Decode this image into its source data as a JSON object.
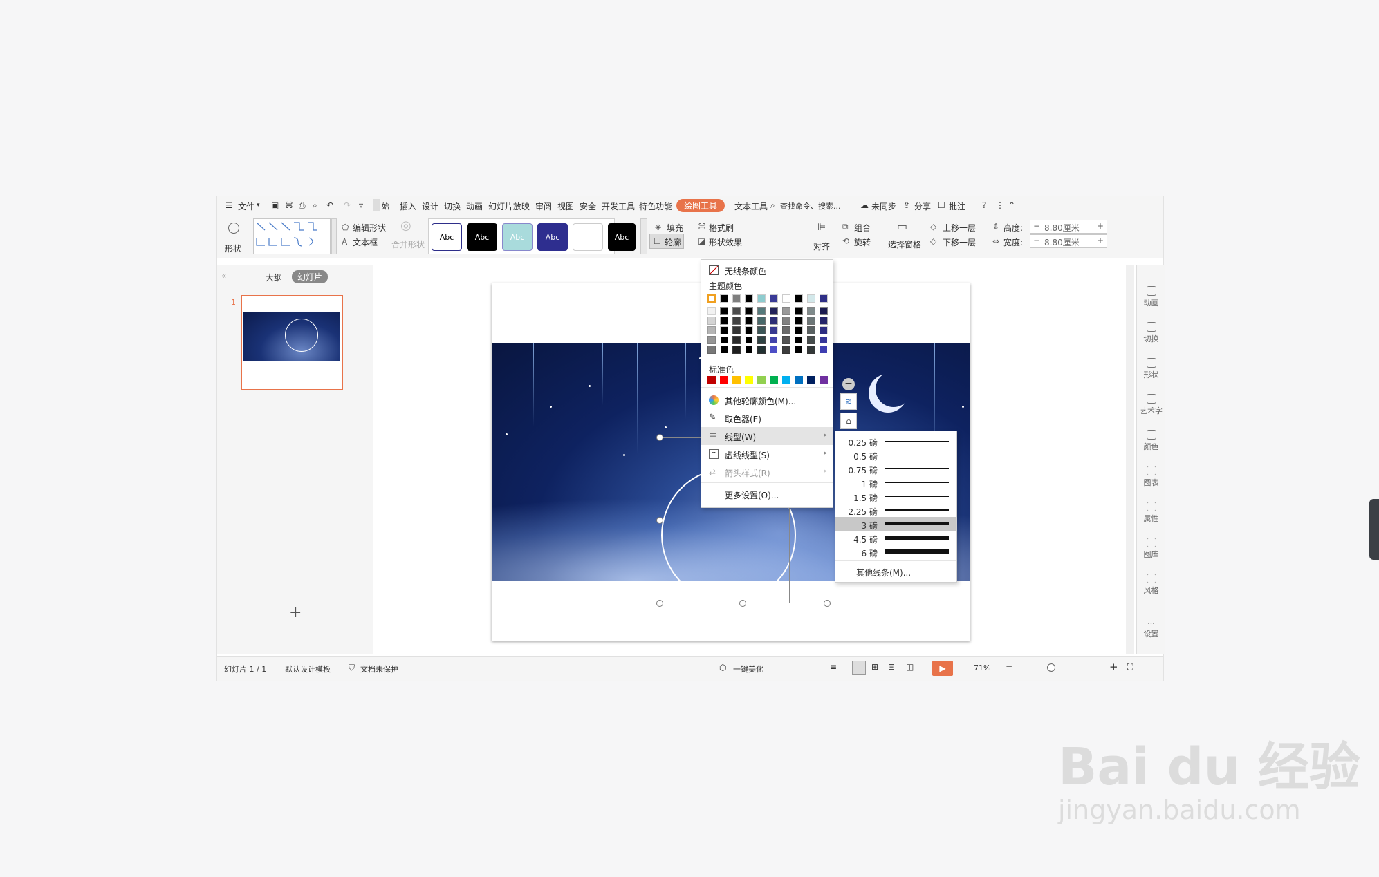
{
  "menubar": {
    "file": "文件",
    "items": [
      "插入",
      "设计",
      "切换",
      "动画",
      "幻灯片放映",
      "审阅",
      "视图",
      "安全",
      "开发工具",
      "特色功能"
    ],
    "active_tab": "绘图工具",
    "text_tool": "文本工具",
    "search": "查找命令、搜索...",
    "sync": "未同步",
    "share": "分享",
    "review": "批注",
    "help": "?"
  },
  "ribbon": {
    "shape": "形状",
    "edit_shape": "编辑形状",
    "textbox": "文本框",
    "merge_shape": "合并形状",
    "style_label": "Abc",
    "fill": "填充",
    "format_brush": "格式刷",
    "outline": "轮廓",
    "shape_effect": "形状效果",
    "align": "对齐",
    "group": "组合",
    "rotate": "旋转",
    "select_pane": "选择窗格",
    "bring_forward": "上移一层",
    "send_backward": "下移一层",
    "height_label": "高度:",
    "height_value": "8.80厘米",
    "width_label": "宽度:",
    "width_value": "8.80厘米"
  },
  "leftpanel": {
    "outline_tab": "大纲",
    "slides_tab": "幻灯片",
    "slide_number": "1",
    "add": "+"
  },
  "rightpanel": [
    "动画",
    "切换",
    "形状",
    "艺术字",
    "颜色",
    "图表",
    "属性",
    "图库",
    "风格",
    "设置"
  ],
  "statusbar": {
    "slide_info": "幻灯片 1 / 1",
    "template": "默认设计模板",
    "protect": "文档未保护",
    "beautify": "一键美化",
    "zoom": "71%"
  },
  "outline_dropdown": {
    "no_line": "无线条颜色",
    "theme_colors": "主题颜色",
    "standard_colors": "标准色",
    "other_colors": "其他轮廓颜色(M)...",
    "eyedropper": "取色器(E)",
    "line_type": "线型(W)",
    "dash_type": "虚线线型(S)",
    "arrow_style": "箭头样式(R)",
    "more_settings": "更多设置(O)...",
    "theme_row": [
      "#ffffff",
      "#000000",
      "#7f7f7f",
      "#000000",
      "#8ecccf",
      "#3a3b96",
      "#ffffff",
      "#000000",
      "#d3e8ea",
      "#2f2f86"
    ],
    "standard_row": [
      "#c00000",
      "#ff0000",
      "#ffc000",
      "#ffff00",
      "#92d050",
      "#00b050",
      "#00b0f0",
      "#0070c0",
      "#002060",
      "#7030a0"
    ]
  },
  "line_weight_menu": {
    "weights": [
      "0.25 磅",
      "0.5 磅",
      "0.75 磅",
      "1 磅",
      "1.5 磅",
      "2.25 磅",
      "3 磅",
      "4.5 磅",
      "6 磅"
    ],
    "selected": "3 磅",
    "other": "其他线条(M)..."
  },
  "watermark": {
    "brand": "Bai du 经验",
    "url": "jingyan.baidu.com"
  }
}
